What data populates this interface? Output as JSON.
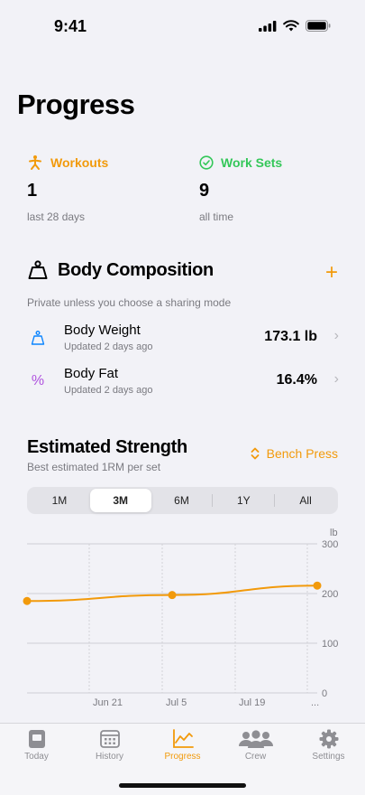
{
  "status": {
    "time": "9:41"
  },
  "page": {
    "title": "Progress"
  },
  "stats": [
    {
      "label": "Workouts",
      "value": "1",
      "sub": "last 28 days",
      "color": "#f29a0b",
      "icon": "figure-run-icon"
    },
    {
      "label": "Work Sets",
      "value": "9",
      "sub": "all time",
      "color": "#34c759",
      "icon": "checkmark-circle-icon"
    }
  ],
  "body_composition": {
    "title": "Body Composition",
    "subtitle": "Private unless you choose a sharing mode",
    "add_label": "+",
    "metrics": [
      {
        "name": "Body Weight",
        "updated": "Updated 2 days ago",
        "value": "173.1 lb",
        "icon": "scale-icon",
        "color": "#0a84ff"
      },
      {
        "name": "Body Fat",
        "updated": "Updated 2 days ago",
        "value": "16.4%",
        "icon": "percent-icon",
        "color": "#af52de"
      }
    ]
  },
  "strength": {
    "title": "Estimated Strength",
    "subtitle": "Best estimated 1RM per set",
    "exercise": "Bench Press",
    "ranges": [
      "1M",
      "3M",
      "6M",
      "1Y",
      "All"
    ],
    "selected_range": "3M"
  },
  "chart_data": {
    "type": "line",
    "x": [
      "Jun 9",
      "Jul 5",
      "Jul 29"
    ],
    "y": [
      185,
      197,
      216
    ],
    "x_tick_labels": [
      "Jun 21",
      "Jul 5",
      "Jul 19",
      "..."
    ],
    "y_tick_labels": [
      "0",
      "100",
      "200",
      "300"
    ],
    "ylabel": "lb",
    "ylim": [
      0,
      300
    ],
    "grid": true,
    "color": "#f29a0b"
  },
  "tabs": [
    {
      "label": "Today",
      "icon": "today-icon",
      "active": false
    },
    {
      "label": "History",
      "icon": "calendar-icon",
      "active": false
    },
    {
      "label": "Progress",
      "icon": "chart-line-icon",
      "active": true
    },
    {
      "label": "Crew",
      "icon": "people-icon",
      "active": false
    },
    {
      "label": "Settings",
      "icon": "gear-icon",
      "active": false
    }
  ],
  "colors": {
    "accent": "#f29a0b",
    "green": "#34c759",
    "blue": "#0a84ff",
    "purple": "#af52de"
  }
}
